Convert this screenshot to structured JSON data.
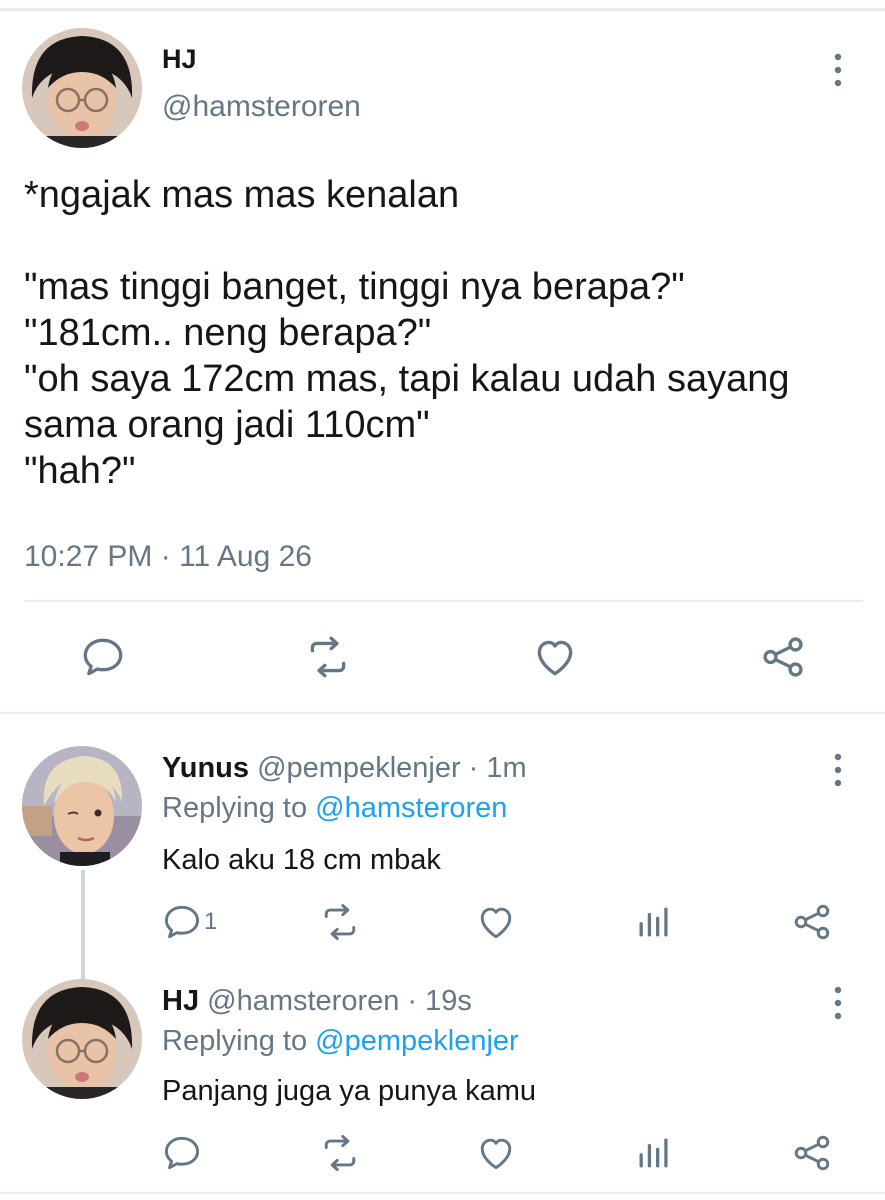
{
  "main_tweet": {
    "author_name": "HJ",
    "author_handle": "@hamsteroren",
    "text": "*ngajak mas mas kenalan\n\n\"mas tinggi banget, tinggi nya berapa?\"\n\"181cm.. neng berapa?\"\n\"oh saya 172cm mas, tapi kalau udah sayang sama orang jadi 110cm\"\n\"hah?\"",
    "timestamp": "10:27 PM · 11 Aug 26",
    "actions": [
      "reply-icon",
      "retweet-icon",
      "like-icon",
      "share-icon"
    ]
  },
  "replies": [
    {
      "author_name": "Yunus",
      "meta": "@pempeklenjer · 1m",
      "replying_prefix": "Replying to ",
      "replying_to": "@hamsteroren",
      "text": "Kalo aku 18 cm mbak",
      "reply_count": "1",
      "actions": [
        "reply-icon",
        "retweet-icon",
        "like-icon",
        "analytics-icon",
        "share-icon"
      ]
    },
    {
      "author_name": "HJ",
      "meta": "@hamsteroren · 19s",
      "replying_prefix": "Replying to ",
      "replying_to": "@pempeklenjer",
      "text": "Panjang juga ya punya kamu",
      "actions": [
        "reply-icon",
        "retweet-icon",
        "like-icon",
        "analytics-icon",
        "share-icon"
      ]
    }
  ],
  "colors": {
    "text": "#14171a",
    "secondary": "#657786",
    "accent": "#1da1f2",
    "icon": "#657786",
    "divider": "#e6ecf0"
  }
}
